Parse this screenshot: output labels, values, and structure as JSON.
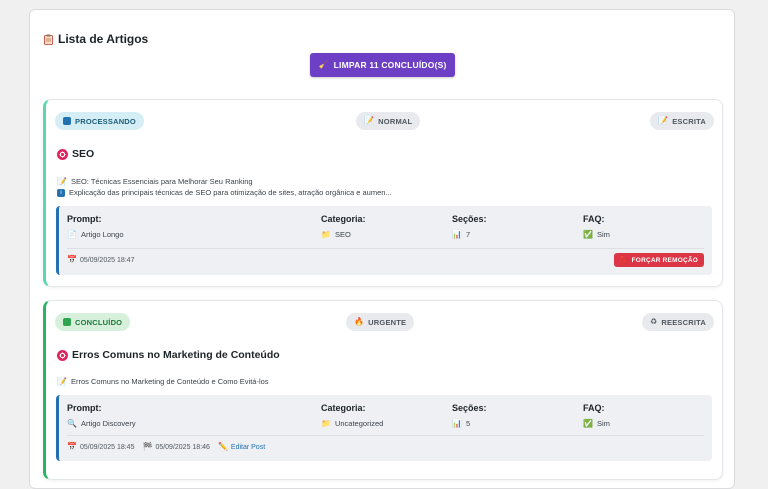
{
  "list": {
    "title": "Lista de Artigos",
    "clear_button": "LIMPAR 11 CONCLUÍDO(S)"
  },
  "labels": {
    "prompt": "Prompt:",
    "category": "Categoria:",
    "sections": "Seções:",
    "faq": "FAQ:"
  },
  "articles": [
    {
      "status": "PROCESSANDO",
      "priority": "NORMAL",
      "type": "ESCRITA",
      "keyword": "SEO",
      "title_line": "SEO: Técnicas Essenciais para Melhorar Seu Ranking",
      "excerpt": "Explicação das principais técnicas de SEO para otimização de sites, atração orgânica e aumen...",
      "prompt": "Artigo Longo",
      "category": "SEO",
      "sections": "7",
      "faq": "Sim",
      "created": "05/09/2025 18:47",
      "force_button": "FORÇAR REMOÇÃO"
    },
    {
      "status": "CONCLUÍDO",
      "priority": "URGENTE",
      "type": "REESCRITA",
      "keyword": "Erros Comuns no Marketing de Conteúdo",
      "title_line": "Erros Comuns no Marketing de Conteúdo e Como Evitá-los",
      "prompt": "Artigo Discovery",
      "category": "Uncategorized",
      "sections": "5",
      "faq": "Sim",
      "created": "05/09/2025 18:45",
      "finished": "05/09/2025 18:46",
      "edit_link": "Editar Post"
    }
  ]
}
